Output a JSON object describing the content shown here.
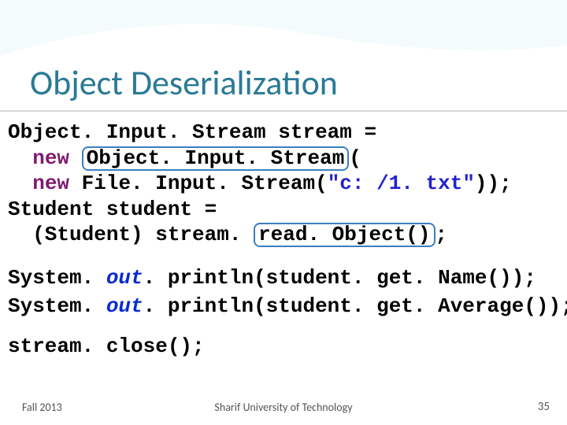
{
  "slide": {
    "title": "Object Deserialization",
    "code": {
      "l1": "Object. Input. Stream stream =",
      "l2a": "  ",
      "l2kw": "new",
      "l2b": " ",
      "l2box": "Object. Input. Stream",
      "l2c": "(",
      "l3a": "  ",
      "l3kw": "new",
      "l3b": " File. Input. Stream(",
      "l3str": "\"c: /1. txt\"",
      "l3c": "));",
      "l4": "Student student =",
      "l5a": "  (Student) stream. ",
      "l5box": "read. Object()",
      "l5c": ";",
      "l6a": "System.",
      "l6out": " out",
      "l6b": ". println(student. get. Name());",
      "l7a": "System.",
      "l7out": " out",
      "l7b": ". println(student. get. Average());",
      "l8": "stream. close();"
    },
    "footer": {
      "left": "Fall 2013",
      "center": "Sharif University of Technology",
      "right": "35"
    }
  }
}
